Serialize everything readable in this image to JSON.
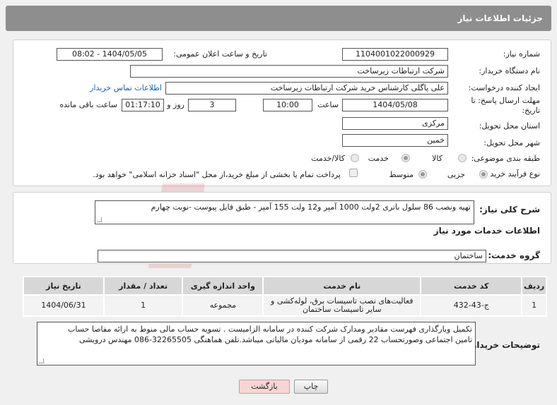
{
  "header": {
    "title": "جزئیات اطلاعات نیاز"
  },
  "fields": {
    "need_number_label": "شماره نیاز:",
    "need_number": "1104001022000929",
    "announce_label": "تاریخ و ساعت اعلان عمومی:",
    "announce_value": "1404/05/05 - 08:02",
    "buyer_org_label": "نام دستگاه خریدار:",
    "buyer_org": "شرکت ارتباطات زیرساخت",
    "requester_label": "ایجاد کننده درخواست:",
    "requester": "علی پاگلی کارشناس خرید شرکت ارتباطات زیرساخت",
    "buyer_contact_link": "اطلاعات تماس خریدار",
    "deadline_label": "مهلت ارسال پاسخ: تا تاریخ:",
    "deadline_date": "1404/05/08",
    "time_label": "ساعت",
    "deadline_time": "10:00",
    "days": "3",
    "days_label": "روز و",
    "remaining_time": "01:17:10",
    "remaining_label": "ساعت باقی مانده",
    "province_label": "استان محل تحویل:",
    "province": "مرکزی",
    "city_label": "شهر محل تحویل:",
    "city": "خمین",
    "category_label": "طبقه بندی موضوعی:",
    "category_options": [
      "کالا",
      "خدمت",
      "کالا/خدمت"
    ],
    "category_selected": "خدمت",
    "process_label": "نوع فرآیند خرید :",
    "process_options": [
      "جزیی",
      "متوسط"
    ],
    "process_selected": "جزیی",
    "payment_note": "پرداخت تمام یا بخشی از مبلغ خرید،از محل \"اسناد خزانه اسلامی\" خواهد بود."
  },
  "summary": {
    "label": "شرح کلی نیاز:",
    "text": "تهیه ونصب 86 سلول باتری 2ولت 1000 آمپر و12 ولت 155 آمپر - طبق فایل پیوست -نوبت چهارم"
  },
  "services": {
    "section_title": "اطلاعات خدمات مورد نیاز",
    "group_label": "گروه خدمت:",
    "group_value": "ساختمان",
    "columns": [
      "ردیف",
      "کد خدمت",
      "نام خدمت",
      "واحد اندازه گیری",
      "تعداد / مقدار",
      "تاریخ نیاز"
    ],
    "rows": [
      [
        "1",
        "ج-43-432",
        "فعالیت‌های نصب تاسیسات برق، لوله‌کشی و سایر تاسیسات ساختمان",
        "مجموعه",
        "1",
        "1404/06/31"
      ]
    ]
  },
  "buyer_notes": {
    "label": "توضیحات خریدار:",
    "line1": "تکمیل وبارگذاری فهرست مقادیر ومدارک شرکت کننده در سامانه الزامیست . تسویه حساب مالی منوط به ارائه مفاصا حساب",
    "line2": "تامین اجتماعی وصورتحساب 22 رقمی از سامانه مودیان مالیاتی میباشد.تلفن هماهنگی 32265505-086 مهندس درویشی"
  },
  "buttons": {
    "print": "چاپ",
    "back": "بازگشت"
  },
  "watermark": {
    "text": "AriaTender.neT"
  }
}
